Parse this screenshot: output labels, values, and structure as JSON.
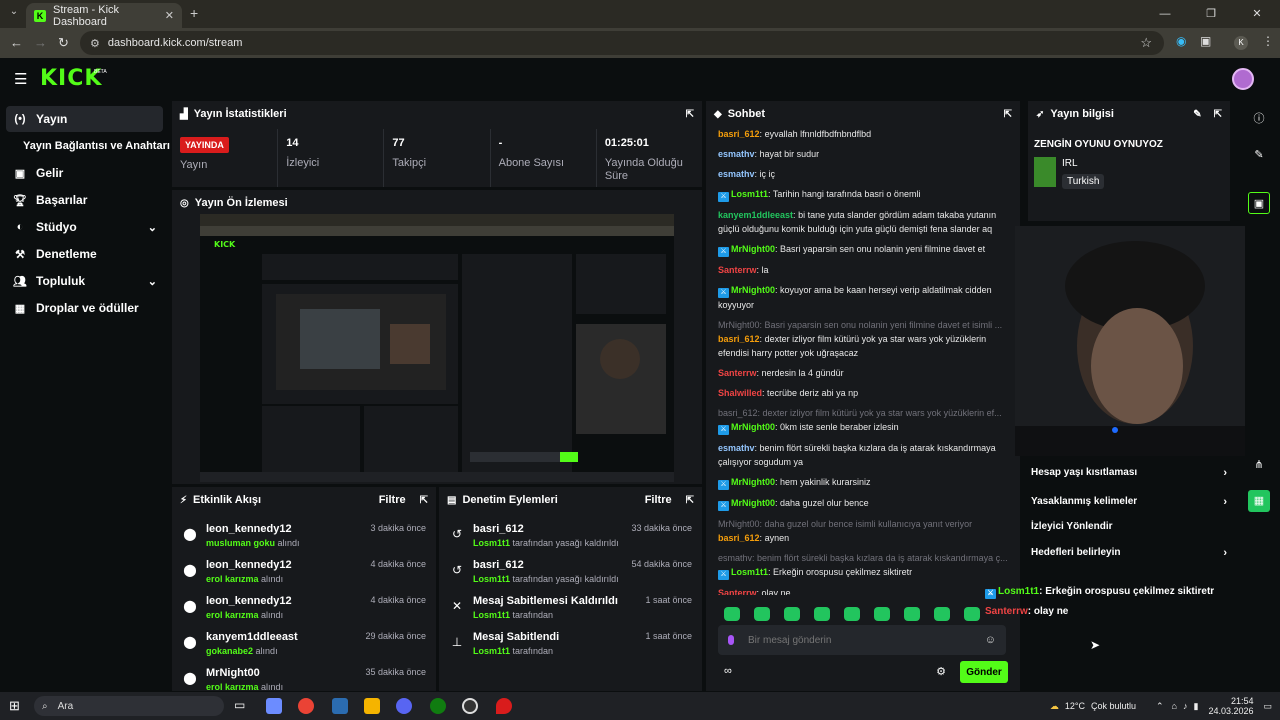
{
  "browser": {
    "tab_title": "Stream - Kick Dashboard",
    "url": "dashboard.kick.com/stream",
    "profile_initial": "K"
  },
  "kick": {
    "logo": "KICK",
    "beta": "BETA"
  },
  "sidebar": {
    "items": [
      {
        "label": "Yayın",
        "icon": "broadcast-icon"
      },
      {
        "label": "Yayın Bağlantısı ve Anahtarı",
        "icon": ""
      },
      {
        "label": "Gelir",
        "icon": "dollar-icon"
      },
      {
        "label": "Başarılar",
        "icon": "trophy-icon"
      },
      {
        "label": "Stüdyo",
        "icon": "palette-icon"
      },
      {
        "label": "Denetleme",
        "icon": "hammer-icon"
      },
      {
        "label": "Topluluk",
        "icon": "users-icon"
      },
      {
        "label": "Droplar ve ödüller",
        "icon": "gift-icon"
      }
    ]
  },
  "stats": {
    "title": "Yayın İstatistikleri",
    "live_badge": "YAYINDA",
    "cells": [
      {
        "value": "",
        "label": "Yayın"
      },
      {
        "value": "14",
        "label": "İzleyici"
      },
      {
        "value": "77",
        "label": "Takipçi"
      },
      {
        "value": "-",
        "label": "Abone Sayısı"
      },
      {
        "value": "01:25:01",
        "label": "Yayında Olduğu Süre"
      }
    ]
  },
  "preview": {
    "title": "Yayın Ön İzlemesi"
  },
  "activity": {
    "title": "Etkinlik Akışı",
    "filter": "Filtre",
    "rows": [
      {
        "name": "leon_kennedy12",
        "sub_user": "musluman goku",
        "sub_text": "alındı",
        "time": "3 dakika önce"
      },
      {
        "name": "leon_kennedy12",
        "sub_user": "erol karızma",
        "sub_text": "alındı",
        "time": "4 dakika önce"
      },
      {
        "name": "leon_kennedy12",
        "sub_user": "erol karızma",
        "sub_text": "alındı",
        "time": "4 dakika önce"
      },
      {
        "name": "kanyem1ddleeast",
        "sub_user": "gokanabe2",
        "sub_text": "alındı",
        "time": "29 dakika önce"
      },
      {
        "name": "MrNight00",
        "sub_user": "erol karızma",
        "sub_text": "alındı",
        "time": "35 dakika önce"
      }
    ]
  },
  "moderation": {
    "title": "Denetim Eylemleri",
    "filter": "Filtre",
    "rows": [
      {
        "name": "basri_612",
        "sub_user": "Losm1t1",
        "sub_text": "tarafından yasağı kaldırıldı",
        "time": "33 dakika önce"
      },
      {
        "name": "basri_612",
        "sub_user": "Losm1t1",
        "sub_text": "tarafından yasağı kaldırıldı",
        "time": "54 dakika önce"
      },
      {
        "name": "Mesaj Sabitlemesi Kaldırıldı",
        "sub_user": "Losm1t1",
        "sub_text": "tarafından",
        "time": "1 saat önce"
      },
      {
        "name": "Mesaj Sabitlendi",
        "sub_user": "Losm1t1",
        "sub_text": "tarafından",
        "time": "1 saat önce"
      }
    ]
  },
  "chat": {
    "title": "Sohbet",
    "messages": [
      {
        "user": "basri_612",
        "color": "#f59e0b",
        "text": "eyvallah lfnnldfbdfnbndflbd"
      },
      {
        "user": "esmathv",
        "color": "#93c5fd",
        "text": "hayat bir sudur"
      },
      {
        "user": "esmathv",
        "color": "#93c5fd",
        "text": "iç iç"
      },
      {
        "user": "Losm1t1",
        "color": "#53fc18",
        "text": "Tarihin hangi tarafında basri o önemli",
        "badge": true
      },
      {
        "user": "kanyem1ddleeast",
        "color": "#22c55e",
        "text": "bi tane yuta slander gördüm adam takaba yutanın güçlü olduğunu komik bulduğı için yuta güçlü demişti fena slander aq"
      },
      {
        "user": "MrNight00",
        "color": "#53fc18",
        "text": "Basri yaparsin sen onu nolanin yeni filmine davet et",
        "badge": true
      },
      {
        "user": "Santerrw",
        "color": "#ef4444",
        "text": "la"
      },
      {
        "user": "MrNight00",
        "color": "#53fc18",
        "text": "koyuyor ama be kaan herseyi verip aldatilmak cidden koyyuyor",
        "badge": true
      },
      {
        "reply": "MrNight00: Basri yaparsin sen onu nolanin yeni filmine davet et isimli ..."
      },
      {
        "user": "basri_612",
        "color": "#f59e0b",
        "text": "dexter izliyor film kütürü yok ya star wars yok yüzüklerin efendisi harry potter yok uğraşacaz"
      },
      {
        "user": "Santerrw",
        "color": "#ef4444",
        "text": "nerdesin la 4 gündür"
      },
      {
        "user": "Shalwilled",
        "color": "#ef4444",
        "text": "tecrübe deriz abi ya np"
      },
      {
        "reply": "basri_612: dexter izliyor film kütürü yok ya star wars yok yüzüklerin ef..."
      },
      {
        "user": "MrNight00",
        "color": "#53fc18",
        "text": "0km iste senle beraber izlesin",
        "badge": true
      },
      {
        "user": "esmathv",
        "color": "#93c5fd",
        "text": "benim flört sürekli başka kızlara da iş atarak kıskandırmaya çalışıyor sogudum ya"
      },
      {
        "user": "MrNight00",
        "color": "#53fc18",
        "text": "hem yakinlik kurarsiniz",
        "badge": true
      },
      {
        "user": "MrNight00",
        "color": "#53fc18",
        "text": "daha guzel olur bence",
        "badge": true
      },
      {
        "reply": "MrNight00: daha guzel olur bence isimli kullanıcıya yanıt veriyor"
      },
      {
        "user": "basri_612",
        "color": "#f59e0b",
        "text": "aynen"
      },
      {
        "reply": "esmathv: benim flört sürekli başka kızlara da iş atarak kıskandırmaya ç..."
      },
      {
        "user": "Losm1t1",
        "color": "#53fc18",
        "text": "Erkeğin orospusu çekilmez siktiretr",
        "badge": true
      },
      {
        "user": "Santerrw",
        "color": "#ef4444",
        "text": "olay ne"
      }
    ],
    "input_placeholder": "Bir mesaj gönderin",
    "send_label": "Gönder"
  },
  "info": {
    "title": "Yayın bilgisi",
    "stream_title": "ZENGİN OYUNU OYNUYOZ",
    "category": "IRL",
    "tag": "Turkish"
  },
  "settings_menu": [
    {
      "label": "Hesap yaşı kısıtlaması",
      "chevron": true
    },
    {
      "label": "Yasaklanmış kelimeler",
      "chevron": true
    },
    {
      "label": "İzleyici Yönlendir",
      "chevron": false
    },
    {
      "label": "Hedefleri belirleyin",
      "chevron": true
    }
  ],
  "overlay": [
    {
      "user": "Losm1t1",
      "text": ": Erkeğin orospusu çekilmez siktiretr"
    },
    {
      "user": "Santerrw",
      "text": ": olay ne"
    }
  ],
  "taskbar": {
    "search": "Ara",
    "weather": "12°C",
    "weather_text": "Çok bulutlu",
    "time": "21:54",
    "date": "24.03.2026"
  }
}
